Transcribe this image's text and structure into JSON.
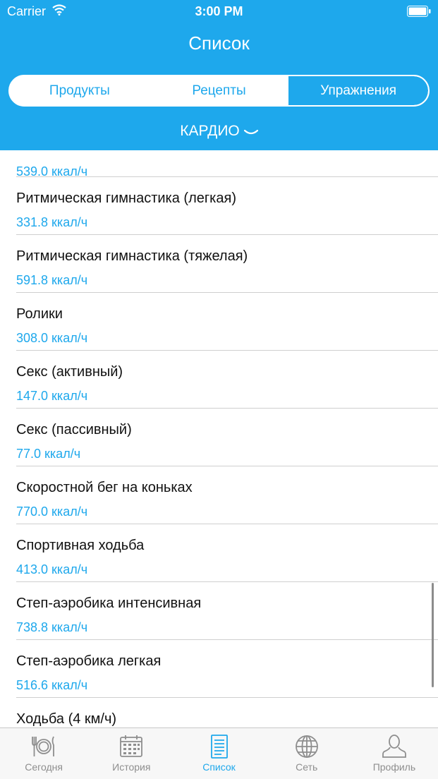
{
  "status_bar": {
    "carrier": "Carrier",
    "time": "3:00 PM"
  },
  "header": {
    "title": "Список"
  },
  "segments": [
    {
      "label": "Продукты",
      "active": false
    },
    {
      "label": "Рецепты",
      "active": false
    },
    {
      "label": "Упражнения",
      "active": true
    }
  ],
  "category": {
    "label": "КАРДИО"
  },
  "list": {
    "partial_top_kcal": "539.0 ккал/ч",
    "items": [
      {
        "name": "Ритмическая гимнастика (легкая)",
        "kcal": "331.8 ккал/ч"
      },
      {
        "name": "Ритмическая гимнастика (тяжелая)",
        "kcal": "591.8 ккал/ч"
      },
      {
        "name": "Ролики",
        "kcal": "308.0 ккал/ч"
      },
      {
        "name": "Секс (активный)",
        "kcal": "147.0 ккал/ч"
      },
      {
        "name": "Секс (пассивный)",
        "kcal": "77.0 ккал/ч"
      },
      {
        "name": "Скоростной бег на коньках",
        "kcal": "770.0 ккал/ч"
      },
      {
        "name": "Спортивная ходьба",
        "kcal": "413.0 ккал/ч"
      },
      {
        "name": "Степ-аэробика интенсивная",
        "kcal": "738.8 ккал/ч"
      },
      {
        "name": "Степ-аэробика легкая",
        "kcal": "516.6 ккал/ч"
      },
      {
        "name": "Ходьба (4 км/ч)",
        "kcal": ""
      }
    ]
  },
  "tabbar": [
    {
      "label": "Сегодня",
      "icon": "plate-cutlery-icon",
      "active": false
    },
    {
      "label": "История",
      "icon": "calendar-icon",
      "active": false
    },
    {
      "label": "Список",
      "icon": "list-document-icon",
      "active": true
    },
    {
      "label": "Сеть",
      "icon": "globe-icon",
      "active": false
    },
    {
      "label": "Профиль",
      "icon": "person-icon",
      "active": false
    }
  ],
  "colors": {
    "accent": "#1ea8ec",
    "tab_inactive": "#8e8e8e",
    "separator": "#cfcfcf"
  }
}
